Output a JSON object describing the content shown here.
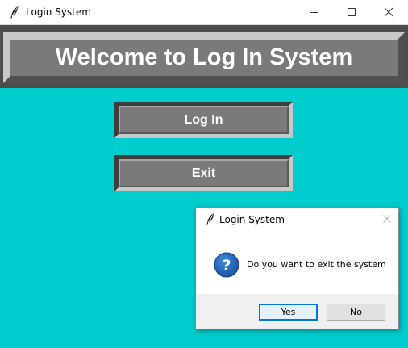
{
  "window": {
    "title": "Login System",
    "controls": {
      "minimize_icon": "minimize-icon",
      "maximize_icon": "maximize-icon",
      "close_icon": "close-icon"
    }
  },
  "header": {
    "title": "Welcome to Log In System"
  },
  "buttons": {
    "login_label": "Log In",
    "exit_label": "Exit"
  },
  "dialog": {
    "title": "Login System",
    "message": "Do you want to exit the system",
    "icon": "question-icon",
    "yes_label": "Yes",
    "no_label": "No"
  },
  "colors": {
    "background": "#00cdcd",
    "button_face": "#7a7a7a",
    "dark_band": "#4d4d4d",
    "dialog_accent": "#0078d7",
    "question_icon": "#1b63b7"
  }
}
